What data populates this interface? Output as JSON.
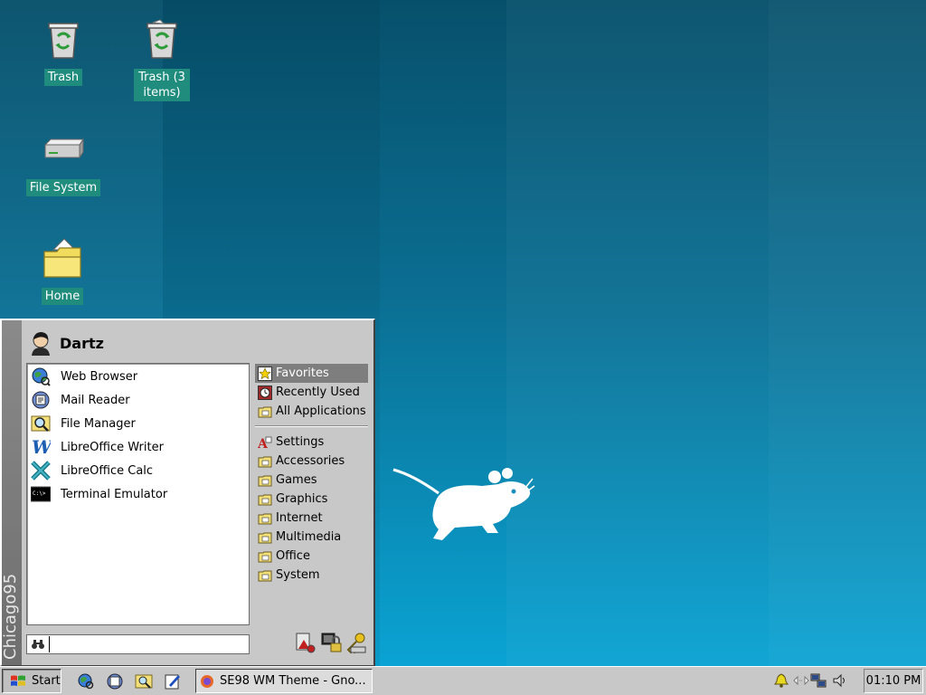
{
  "desktop": {
    "icons": [
      {
        "label": "Trash",
        "icon": "trash-icon"
      },
      {
        "label": "Trash (3 items)",
        "icon": "trash-full-icon"
      },
      {
        "label": "File System",
        "icon": "drive-icon"
      },
      {
        "label": "Home",
        "icon": "home-folder-icon"
      }
    ]
  },
  "start_menu": {
    "banner": "Chicago95",
    "user": "Dartz",
    "favorites": [
      {
        "label": "Web Browser",
        "icon": "globe-icon"
      },
      {
        "label": "Mail Reader",
        "icon": "mail-icon"
      },
      {
        "label": "File Manager",
        "icon": "magnifier-icon"
      },
      {
        "label": "LibreOffice Writer",
        "icon": "writer-icon"
      },
      {
        "label": "LibreOffice Calc",
        "icon": "calc-icon"
      },
      {
        "label": "Terminal Emulator",
        "icon": "terminal-icon"
      }
    ],
    "top_categories": [
      {
        "label": "Favorites",
        "selected": true
      },
      {
        "label": "Recently Used"
      },
      {
        "label": "All Applications"
      }
    ],
    "categories": [
      "Settings",
      "Accessories",
      "Games",
      "Graphics",
      "Internet",
      "Multimedia",
      "Office",
      "System"
    ],
    "search": {
      "value": ""
    },
    "actions": [
      "settings-tools-icon",
      "lock-screen-icon",
      "log-out-icon"
    ]
  },
  "taskbar": {
    "start_label": "Start",
    "task_label": "SE98 WM Theme - Gno...",
    "clock": "01:10 PM"
  },
  "colors": {
    "desktop_top": "#07506b",
    "desktop_bottom": "#0aa3d3",
    "panel_gray": "#c8c8c8",
    "icon_label_bg": "#1f8c7e",
    "selection": "#7e7e7e"
  }
}
